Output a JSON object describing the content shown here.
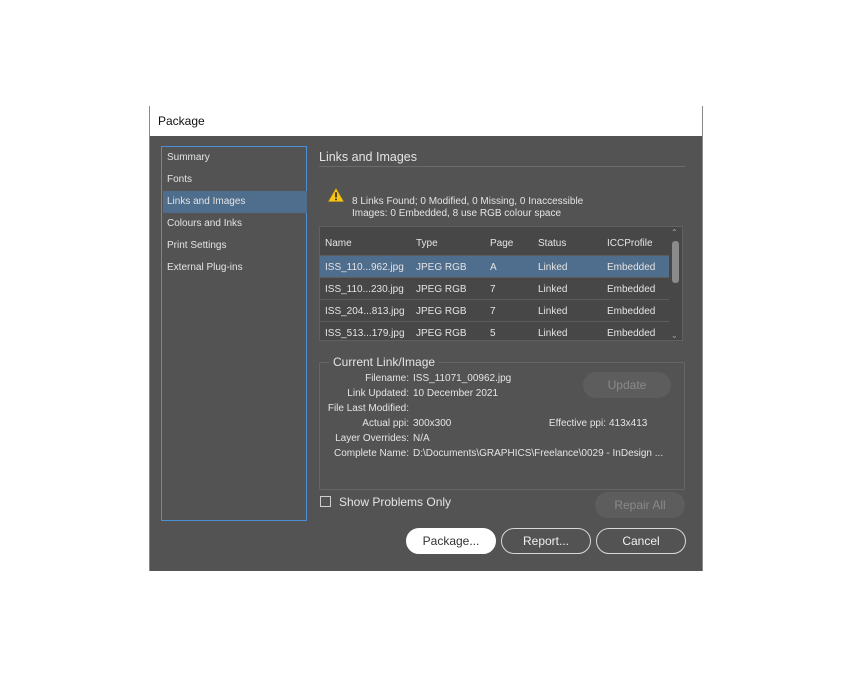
{
  "window": {
    "title": "Package"
  },
  "sidebar": {
    "items": [
      {
        "label": "Summary"
      },
      {
        "label": "Fonts"
      },
      {
        "label": "Links and Images"
      },
      {
        "label": "Colours and Inks"
      },
      {
        "label": "Print Settings"
      },
      {
        "label": "External Plug-ins"
      }
    ],
    "selected": "Links and Images"
  },
  "main": {
    "title": "Links and Images",
    "summary_line1": "8 Links Found; 0 Modified, 0 Missing, 0 Inaccessible",
    "summary_line2": "Images: 0 Embedded, 8 use RGB colour space",
    "warning_icon": "warning-triangle-icon",
    "table": {
      "columns": [
        "Name",
        "Type",
        "Page",
        "Status",
        "ICCProfile"
      ],
      "rows": [
        {
          "name": "ISS_110...962.jpg",
          "type": "JPEG RGB",
          "page": "A",
          "status": "Linked",
          "icc": "Embedded"
        },
        {
          "name": "ISS_110...230.jpg",
          "type": "JPEG RGB",
          "page": "7",
          "status": "Linked",
          "icc": "Embedded"
        },
        {
          "name": "ISS_204...813.jpg",
          "type": "JPEG RGB",
          "page": "7",
          "status": "Linked",
          "icc": "Embedded"
        },
        {
          "name": "ISS_513...179.jpg",
          "type": "JPEG RGB",
          "page": "5",
          "status": "Linked",
          "icc": "Embedded"
        }
      ]
    },
    "current": {
      "legend": "Current Link/Image",
      "filename_label": "Filename:",
      "filename": "ISS_11071_00962.jpg",
      "updated_label": "Link Updated:",
      "updated": "10 December 2021",
      "modified_label": "File Last Modified:",
      "modified": "",
      "actual_label": "Actual ppi:",
      "actual": "300x300",
      "effective_label": "Effective ppi:",
      "effective": "413x413",
      "overrides_label": "Layer Overrides:",
      "overrides": "N/A",
      "complete_label": "Complete Name:",
      "complete": "D:\\Documents\\GRAPHICS\\Freelance\\0029 - InDesign ...",
      "update_button": "Update"
    },
    "show_problems_label": "Show Problems Only",
    "show_problems_checked": false,
    "repair_all_button": "Repair All"
  },
  "footer": {
    "package_button": "Package...",
    "report_button": "Report...",
    "cancel_button": "Cancel"
  },
  "colors": {
    "dialog_bg": "#535353",
    "selection": "#4f6d8c",
    "sidebar_border": "#4a90d9",
    "warning": "#f5c518"
  }
}
